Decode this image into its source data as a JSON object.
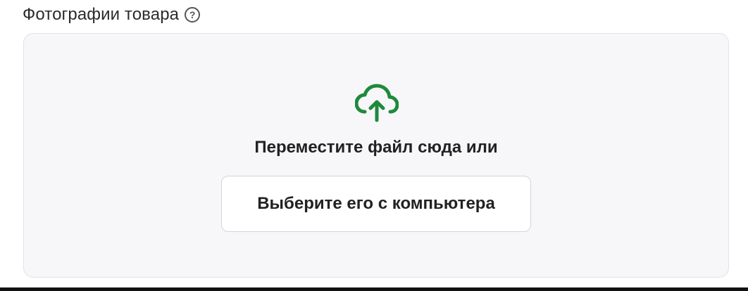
{
  "section": {
    "title": "Фотографии товара",
    "help_icon_glyph": "?"
  },
  "dropzone": {
    "icon": "cloud-upload-icon",
    "icon_color": "#1e8a3c",
    "drop_text": "Переместите файл сюда или",
    "choose_button_label": "Выберите его с компьютера"
  }
}
